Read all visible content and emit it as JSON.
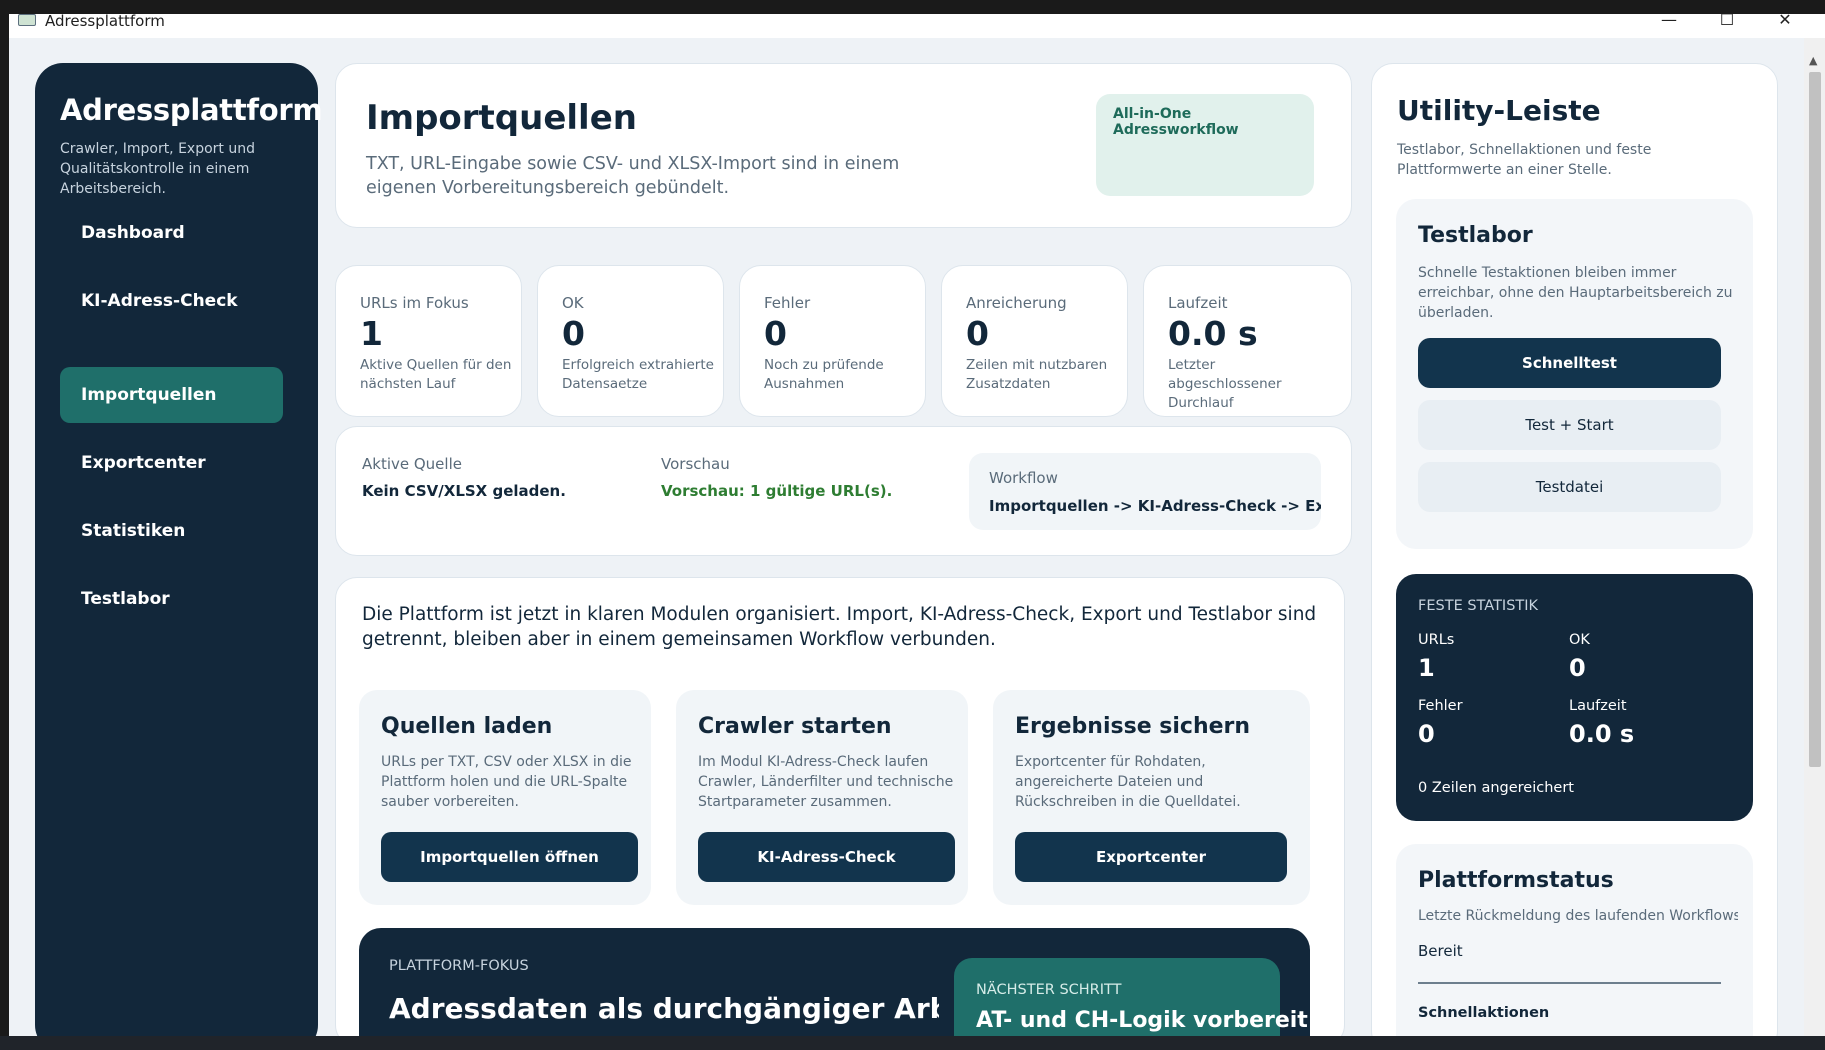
{
  "window": {
    "title": "Adressplattform",
    "minimize": "—",
    "maximize": "☐",
    "close": "✕"
  },
  "sidebar": {
    "title": "Adressplattform",
    "subtitle": "Crawler, Import, Export und Qualitätskontrolle in einem Arbeitsbereich.",
    "items": [
      {
        "label": "Dashboard",
        "active": false
      },
      {
        "label": "KI-Adress-Check",
        "active": false
      },
      {
        "label": "Importquellen",
        "active": true
      },
      {
        "label": "Exportcenter",
        "active": false
      },
      {
        "label": "Statistiken",
        "active": false
      },
      {
        "label": "Testlabor",
        "active": false
      }
    ]
  },
  "header": {
    "title": "Importquellen",
    "description": "TXT, URL-Eingabe sowie CSV- und XLSX-Import sind in einem eigenen Vorbereitungsbereich gebündelt.",
    "badge": "All-in-One Adressworkflow"
  },
  "stats": [
    {
      "label": "URLs im Fokus",
      "value": "1",
      "desc": "Aktive Quellen für den nächsten Lauf"
    },
    {
      "label": "OK",
      "value": "0",
      "desc": "Erfolgreich extrahierte Datensaetze"
    },
    {
      "label": "Fehler",
      "value": "0",
      "desc": "Noch zu prüfende Ausnahmen"
    },
    {
      "label": "Anreicherung",
      "value": "0",
      "desc": "Zeilen mit nutzbaren Zusatzdaten"
    },
    {
      "label": "Laufzeit",
      "value": "0.0 s",
      "desc": "Letzter abgeschlossener Durchlauf"
    }
  ],
  "info": {
    "source_label": "Aktive Quelle",
    "source_value": "Kein CSV/XLSX geladen.",
    "preview_label": "Vorschau",
    "preview_value": "Vorschau: 1 gültige URL(s).",
    "workflow_label": "Workflow",
    "workflow_value": "Importquellen -> KI-Adress-Check -> Exportc"
  },
  "overview": {
    "text": "Die Plattform ist jetzt in klaren Modulen organisiert. Import, KI-Adress-Check, Export und Testlabor sind getrennt, bleiben aber in einem gemeinsamen Workflow verbunden.",
    "modules": [
      {
        "title": "Quellen laden",
        "desc": "URLs per TXT, CSV oder XLSX in die Plattform holen und die URL-Spalte sauber vorbereiten.",
        "button": "Importquellen öffnen"
      },
      {
        "title": "Crawler starten",
        "desc": "Im Modul KI-Adress-Check laufen Crawler, Länderfilter und technische Startparameter zusammen.",
        "button": "KI-Adress-Check"
      },
      {
        "title": "Ergebnisse sichern",
        "desc": "Exportcenter für Rohdaten, angereicherte Dateien und Rückschreiben in die Quelldatei.",
        "button": "Exportcenter"
      }
    ]
  },
  "focus": {
    "kicker": "PLATTFORM-FOKUS",
    "title": "Adressdaten als durchgängiger Arbeitsp",
    "next_kicker": "NÄCHSTER SCHRITT",
    "next_title": "AT- und CH-Logik vorbereit"
  },
  "utility": {
    "title": "Utility-Leiste",
    "subtitle": "Testlabor, Schnellaktionen und feste Plattformwerte an einer Stelle.",
    "testlab": {
      "title": "Testlabor",
      "desc": "Schnelle Testaktionen bleiben immer erreichbar, ohne den Hauptarbeitsbereich zu überladen.",
      "btn_quick": "Schnelltest",
      "btn_test_start": "Test + Start",
      "btn_file": "Testdatei"
    },
    "fixed_stats": {
      "title": "FESTE STATISTIK",
      "urls_label": "URLs",
      "urls_value": "1",
      "ok_label": "OK",
      "ok_value": "0",
      "errors_label": "Fehler",
      "errors_value": "0",
      "runtime_label": "Laufzeit",
      "runtime_value": "0.0 s",
      "enriched": "0 Zeilen angereichert"
    },
    "status": {
      "title": "Plattformstatus",
      "desc": "Letzte Rückmeldung des laufenden Workflows",
      "value": "Bereit",
      "quick_actions": "Schnellaktionen"
    }
  }
}
